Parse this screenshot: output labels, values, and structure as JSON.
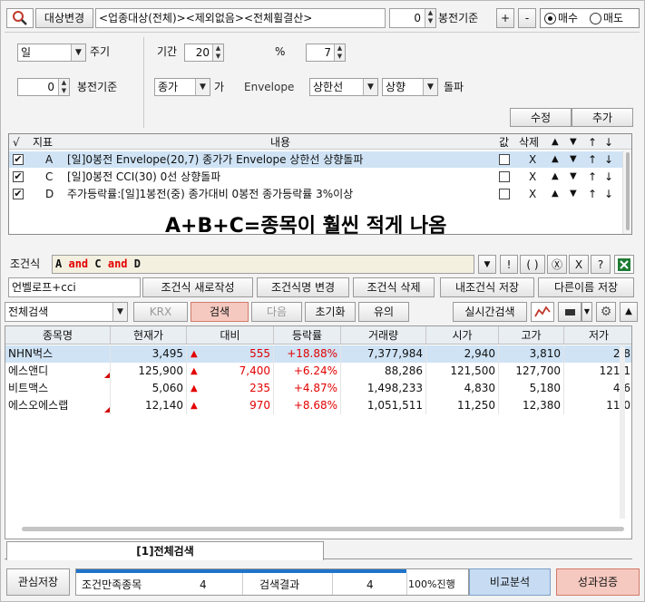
{
  "top": {
    "target_change_label": "대상변경",
    "target_value": "<업종대상(전체)><제외없음><전체휠결산>",
    "bong_value": "0",
    "bong_label": "봉전기준",
    "plus": "+",
    "minus": "-",
    "buy_label": "매수",
    "sell_label": "매도"
  },
  "settings": {
    "period_unit": "일",
    "period_unit_label": "주기",
    "term_label": "기간",
    "term_value": "20",
    "percent_label": "%",
    "percent_value": "7",
    "bong_value": "0",
    "bong_label": "봉전기준",
    "price_type": "종가",
    "ga_label": "가",
    "envelope_label": "Envelope",
    "line_type": "상한선",
    "direction": "상향",
    "breakout_label": "돌파",
    "edit_label": "수정",
    "add_label": "추가"
  },
  "conditions": {
    "headers": {
      "check": "√",
      "indicator": "지표",
      "content": "내용",
      "value": "값",
      "delete": "삭제",
      "up": "▲",
      "down": "▼",
      "top": "↑",
      "bottom": "↓"
    },
    "rows": [
      {
        "id": "A",
        "text": "[일]0봉전 Envelope(20,7) 종가가 Envelope 상한선 상향돌파",
        "del": "X",
        "up": "▲",
        "down": "▼",
        "top": "↑",
        "bottom": "↓"
      },
      {
        "id": "C",
        "text": "[일]0봉전 CCI(30) 0선 상향돌파",
        "del": "X",
        "up": "▲",
        "down": "▼",
        "top": "↑",
        "bottom": "↓"
      },
      {
        "id": "D",
        "text": "주가등락률:[일]1봉전(중) 종가대비 0봉전 종가등락률 3%이상",
        "del": "X",
        "up": "▲",
        "down": "▼",
        "top": "↑",
        "bottom": "↓"
      }
    ],
    "overlay": "A+B+C=종목이 훨씬 적게 나옴"
  },
  "formula": {
    "label": "조건식",
    "t1": "A",
    "t2": "and",
    "t3": "C",
    "t4": "and",
    "t5": "D",
    "sym_down": "▼",
    "sym_excl": "!",
    "sym_paren": "( )",
    "sym_circle": "Ⓧ",
    "sym_x": "X",
    "sym_q": "?"
  },
  "name_row": {
    "name_value": "언벨로프+cci",
    "new_label": "조건식 새로작성",
    "rename_label": "조건식명 변경",
    "delete_label": "조건식 삭제",
    "my_save_label": "내조건식 저장",
    "save_as_label": "다른이름 저장"
  },
  "search_bar": {
    "scope": "전체검색",
    "krx": "KRX",
    "search": "검색",
    "next": "다음",
    "reset": "초기화",
    "caution": "유의",
    "realtime": "실시간검색"
  },
  "results": {
    "headers": [
      "종목명",
      "현재가",
      "대비",
      "등락률",
      "거래량",
      "시가",
      "고가",
      "저가"
    ],
    "rows": [
      {
        "name": "NHN벅스",
        "price": "3,495",
        "change": "555",
        "rate": "+18.88%",
        "volume": "7,377,984",
        "open": "2,940",
        "high": "3,810",
        "low": "2,8"
      },
      {
        "name": "에스앤디",
        "price": "125,900",
        "change": "7,400",
        "rate": "+6.24%",
        "volume": "88,286",
        "open": "121,500",
        "high": "127,700",
        "low": "121,1"
      },
      {
        "name": "비트맥스",
        "price": "5,060",
        "change": "235",
        "rate": "+4.87%",
        "volume": "1,498,233",
        "open": "4,830",
        "high": "5,180",
        "low": "4,6"
      },
      {
        "name": "에스오에스랩",
        "price": "12,140",
        "change": "970",
        "rate": "+8.68%",
        "volume": "1,051,511",
        "open": "11,250",
        "high": "12,380",
        "low": "11,0"
      }
    ],
    "up_symbol": "▲"
  },
  "tab": {
    "label": "[1]전체검색"
  },
  "bottom": {
    "watch_save": "관심저장",
    "match_label": "조건만족종목",
    "match_count": "4",
    "result_label": "검색결과",
    "result_count": "4",
    "progress_text": "100%진행",
    "progress": 1.0,
    "compare": "비교분석",
    "performance": "성과검증"
  },
  "colors": {
    "up": "#e30000",
    "highlight_row": "#cfe3f5",
    "search_btn": "#f6c9c0"
  }
}
